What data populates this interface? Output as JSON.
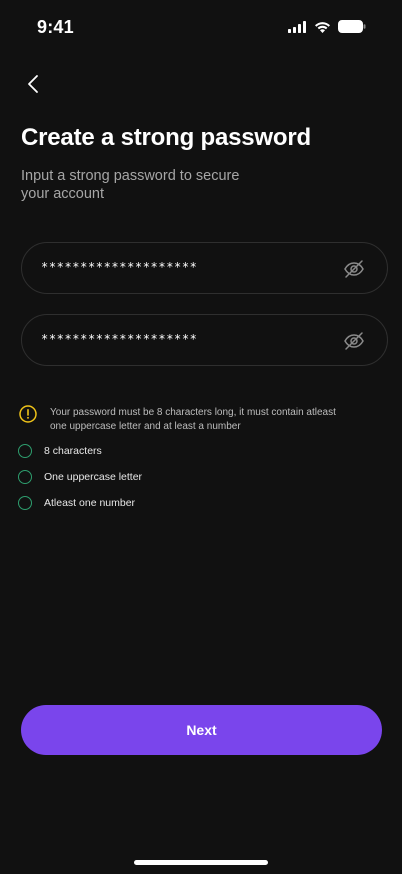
{
  "status_bar": {
    "time": "9:41",
    "icons": [
      "cellular-signal-icon",
      "wifi-icon",
      "battery-icon"
    ]
  },
  "header": {
    "back_icon": "chevron-left-icon",
    "title": "Create a strong password",
    "subtitle": "Input a strong password to secure your account"
  },
  "form": {
    "password": {
      "value": "********************",
      "toggle_icon": "eye-off-icon"
    },
    "confirm_password": {
      "value": "********************",
      "toggle_icon": "eye-off-icon"
    }
  },
  "requirements": {
    "hint_icon": "warning-circle-icon",
    "hint": "Your password must be 8 characters long, it must contain atleast one uppercase letter and at least a number",
    "items": [
      {
        "label": "8 characters",
        "met": false
      },
      {
        "label": "One uppercase letter",
        "met": false
      },
      {
        "label": "Atleast one number",
        "met": false
      }
    ]
  },
  "footer": {
    "next_label": "Next"
  },
  "colors": {
    "background": "#111111",
    "accent": "#7a45ec",
    "warning": "#f0c419",
    "check_ring": "#2e9e6e",
    "field_border": "#2f2f2f"
  }
}
